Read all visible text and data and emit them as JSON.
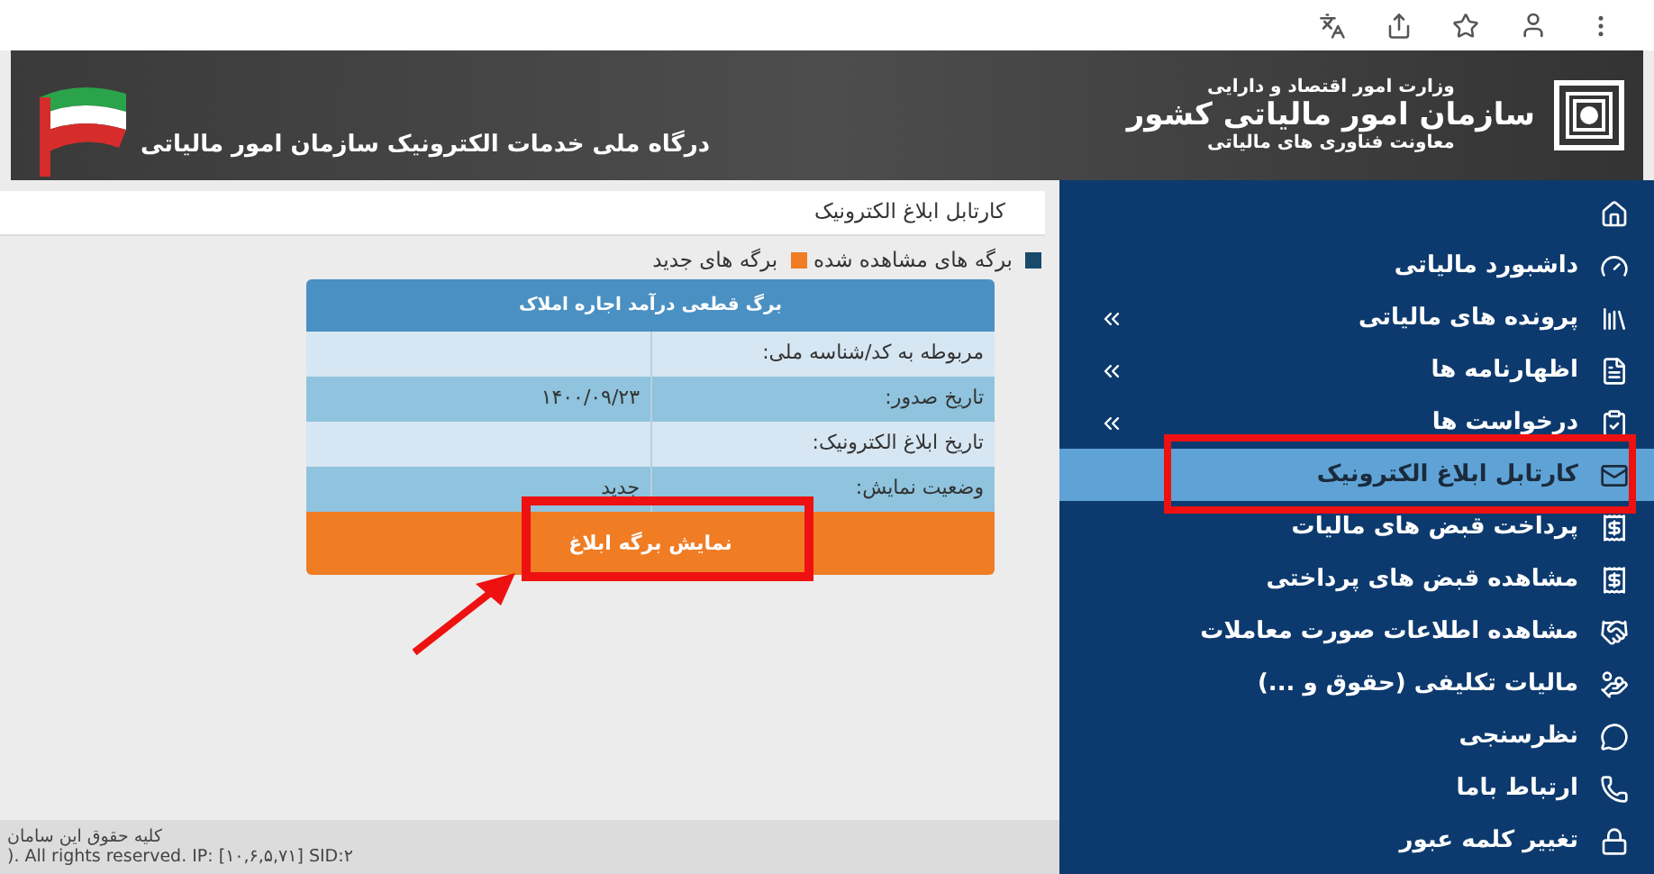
{
  "header": {
    "portal_title": "درگاه ملی خدمات الکترونیک سازمان امور مالیاتی",
    "ministry": "وزارت امور اقتصاد و دارایی",
    "organization": "سازمان امور مالیاتی کشور",
    "deputy": "معاونت فناوری های مالیاتی"
  },
  "sidebar": {
    "items": [
      {
        "kind": "home",
        "selected": false
      },
      {
        "kind": "link",
        "label": "داشبورد مالیاتی",
        "expandable": false,
        "selected": false
      },
      {
        "kind": "link",
        "label": "پرونده های مالیاتی",
        "expandable": true,
        "selected": false
      },
      {
        "kind": "link",
        "label": "اظهارنامه ها",
        "expandable": true,
        "selected": false
      },
      {
        "kind": "link",
        "label": "درخواست ها",
        "expandable": true,
        "selected": false
      },
      {
        "kind": "link",
        "label": "کارتابل ابلاغ الکترونیک",
        "expandable": false,
        "selected": true
      },
      {
        "kind": "link",
        "label": "پرداخت قبض های مالیات",
        "expandable": false,
        "selected": false
      },
      {
        "kind": "link",
        "label": "مشاهده قبض های پرداختی",
        "expandable": false,
        "selected": false
      },
      {
        "kind": "link",
        "label": "مشاهده اطلاعات صورت معاملات",
        "expandable": false,
        "selected": false
      },
      {
        "kind": "link",
        "label": "مالیات تکلیفی (حقوق و ...)",
        "expandable": false,
        "selected": false
      },
      {
        "kind": "link",
        "label": "نظرسنجی",
        "expandable": false,
        "selected": false
      },
      {
        "kind": "link",
        "label": "ارتباط باما",
        "expandable": false,
        "selected": false
      },
      {
        "kind": "link",
        "label": "تغییر کلمه عبور",
        "expandable": false,
        "selected": false
      }
    ]
  },
  "page_title": "کارتابل ابلاغ الکترونیک",
  "legend": [
    {
      "label": "برگه های مشاهده شده",
      "color": "#1a4a6a"
    },
    {
      "label": "برگه های جدید",
      "color": "#f07c23"
    }
  ],
  "notice_card": {
    "title": "برگ قطعی درآمد اجاره املاک",
    "rows": [
      {
        "label": "مربوطه به کد/شناسه ملی:"
      },
      {
        "label": "تاریخ صدور:",
        "value": "۱۴۰۰/۰۹/۲۳"
      },
      {
        "label": "تاریخ ابلاغ الکترونیک:"
      },
      {
        "label": "وضعیت نمایش:",
        "value": "جدید"
      }
    ],
    "button": "نمایش برگه ابلاغ"
  },
  "footer": [
    "کلیه حقوق این سامان",
    "). All rights reserved. IP: [۱۰,۶,۵,۷۱] SID:۲"
  ]
}
